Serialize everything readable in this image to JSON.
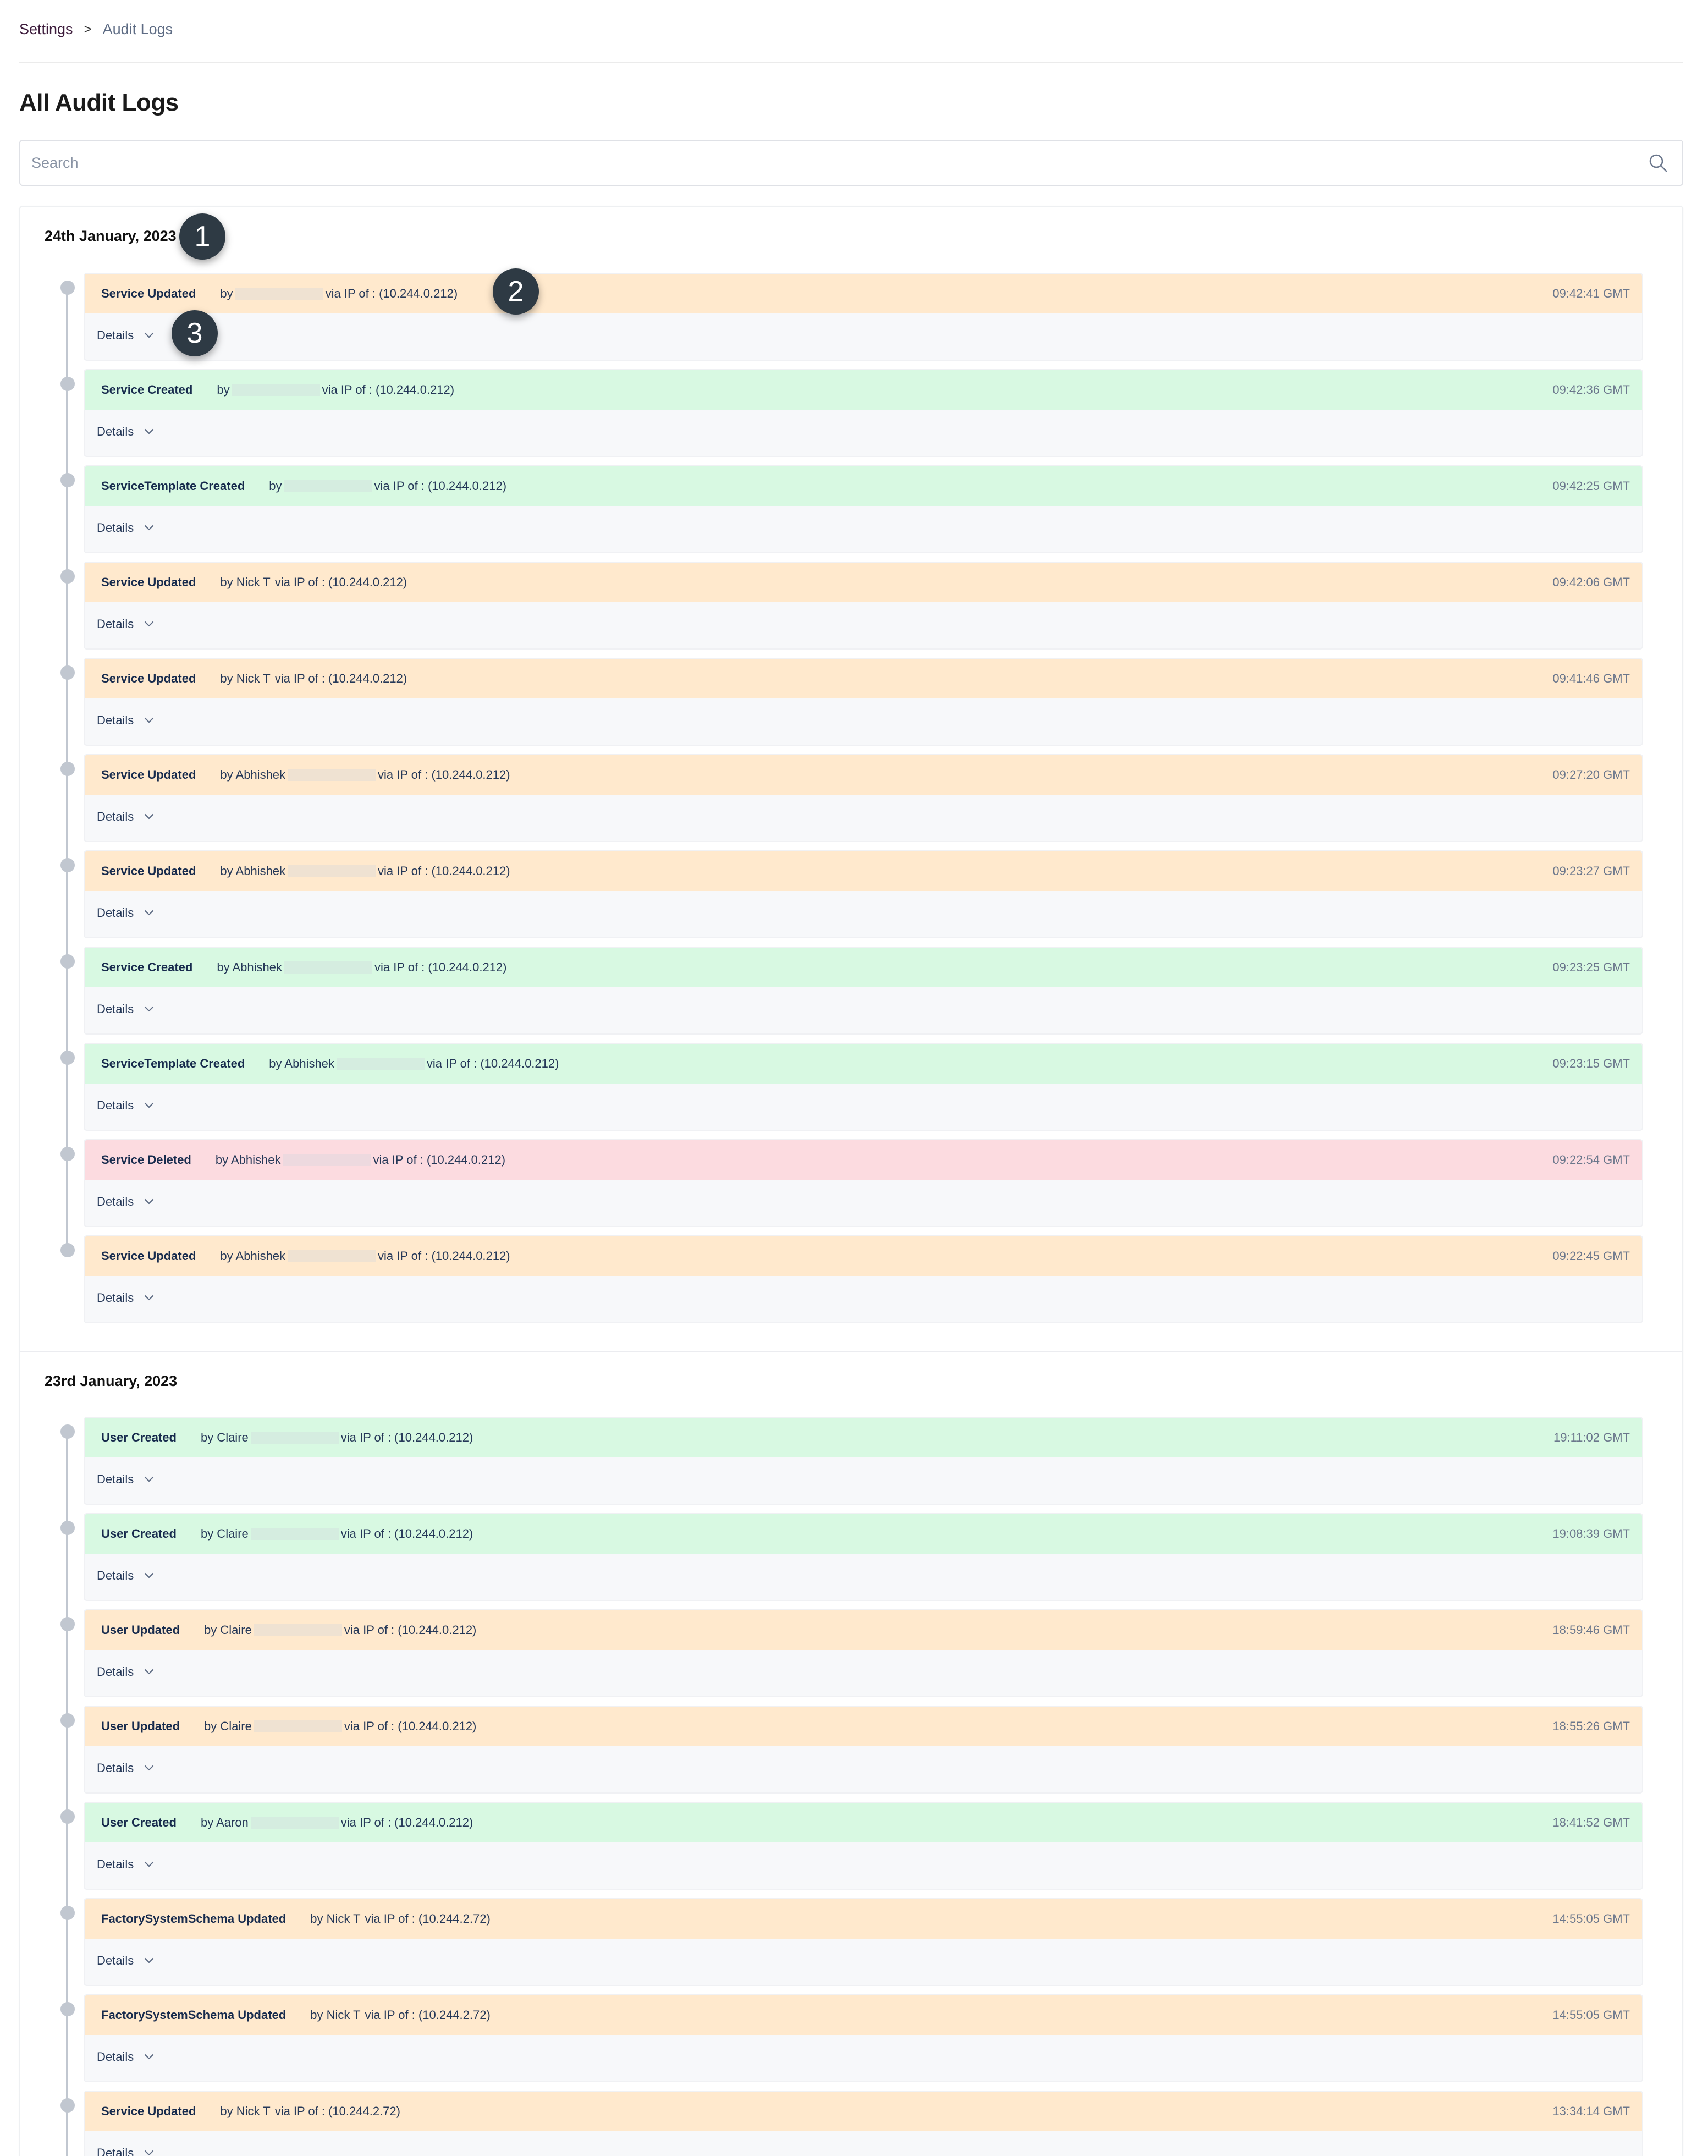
{
  "breadcrumb": {
    "root": "Settings",
    "separator": ">",
    "current": "Audit Logs"
  },
  "page": {
    "title": "All Audit Logs"
  },
  "search": {
    "placeholder": "Search"
  },
  "colors": {
    "updated": "#ffe9cd",
    "created": "#d8f9e2",
    "deleted": "#fcdbe0",
    "timeline": "#c1c7d0"
  },
  "icons": {
    "search": "magnifier-icon",
    "details": "chevron-down-icon"
  },
  "markers": [
    "1",
    "2",
    "3"
  ],
  "details_label": "Details",
  "groups": [
    {
      "date": "24th January, 2023",
      "entries": [
        {
          "event": "Service Updated",
          "by": "by",
          "redacted": true,
          "ip": "via IP of : (10.244.0.212)",
          "time": "09:42:41 GMT",
          "kind": "updated"
        },
        {
          "event": "Service Created",
          "by": "by",
          "redacted": true,
          "ip": "via IP of : (10.244.0.212)",
          "time": "09:42:36 GMT",
          "kind": "created"
        },
        {
          "event": "ServiceTemplate Created",
          "by": "by",
          "redacted": true,
          "ip": "via IP of : (10.244.0.212)",
          "time": "09:42:25 GMT",
          "kind": "created"
        },
        {
          "event": "Service Updated",
          "by": "by Nick T",
          "redacted": false,
          "ip": "via IP of : (10.244.0.212)",
          "time": "09:42:06 GMT",
          "kind": "updated"
        },
        {
          "event": "Service Updated",
          "by": "by Nick T",
          "redacted": false,
          "ip": "via IP of : (10.244.0.212)",
          "time": "09:41:46 GMT",
          "kind": "updated"
        },
        {
          "event": "Service Updated",
          "by": "by Abhishek",
          "redacted": true,
          "ip": "via IP of : (10.244.0.212)",
          "time": "09:27:20 GMT",
          "kind": "updated"
        },
        {
          "event": "Service Updated",
          "by": "by Abhishek",
          "redacted": true,
          "ip": "via IP of : (10.244.0.212)",
          "time": "09:23:27 GMT",
          "kind": "updated"
        },
        {
          "event": "Service Created",
          "by": "by Abhishek",
          "redacted": true,
          "ip": "via IP of : (10.244.0.212)",
          "time": "09:23:25 GMT",
          "kind": "created"
        },
        {
          "event": "ServiceTemplate Created",
          "by": "by Abhishek",
          "redacted": true,
          "ip": "via IP of : (10.244.0.212)",
          "time": "09:23:15 GMT",
          "kind": "created"
        },
        {
          "event": "Service Deleted",
          "by": "by Abhishek",
          "redacted": true,
          "ip": "via IP of : (10.244.0.212)",
          "time": "09:22:54 GMT",
          "kind": "deleted"
        },
        {
          "event": "Service Updated",
          "by": "by Abhishek",
          "redacted": true,
          "ip": "via IP of : (10.244.0.212)",
          "time": "09:22:45 GMT",
          "kind": "updated"
        }
      ]
    },
    {
      "date": "23rd January, 2023",
      "entries": [
        {
          "event": "User Created",
          "by": "by Claire",
          "redacted": true,
          "ip": "via IP of : (10.244.0.212)",
          "time": "19:11:02 GMT",
          "kind": "created"
        },
        {
          "event": "User Created",
          "by": "by Claire",
          "redacted": true,
          "ip": "via IP of : (10.244.0.212)",
          "time": "19:08:39 GMT",
          "kind": "created"
        },
        {
          "event": "User Updated",
          "by": "by Claire",
          "redacted": true,
          "ip": "via IP of : (10.244.0.212)",
          "time": "18:59:46 GMT",
          "kind": "updated"
        },
        {
          "event": "User Updated",
          "by": "by Claire",
          "redacted": true,
          "ip": "via IP of : (10.244.0.212)",
          "time": "18:55:26 GMT",
          "kind": "updated"
        },
        {
          "event": "User Created",
          "by": "by Aaron",
          "redacted": true,
          "ip": "via IP of : (10.244.0.212)",
          "time": "18:41:52 GMT",
          "kind": "created"
        },
        {
          "event": "FactorySystemSchema Updated",
          "by": "by Nick T",
          "redacted": false,
          "ip": "via IP of : (10.244.2.72)",
          "time": "14:55:05 GMT",
          "kind": "updated"
        },
        {
          "event": "FactorySystemSchema Updated",
          "by": "by Nick T",
          "redacted": false,
          "ip": "via IP of : (10.244.2.72)",
          "time": "14:55:05 GMT",
          "kind": "updated"
        },
        {
          "event": "Service Updated",
          "by": "by Nick T",
          "redacted": false,
          "ip": "via IP of : (10.244.2.72)",
          "time": "13:34:14 GMT",
          "kind": "updated"
        }
      ]
    }
  ]
}
